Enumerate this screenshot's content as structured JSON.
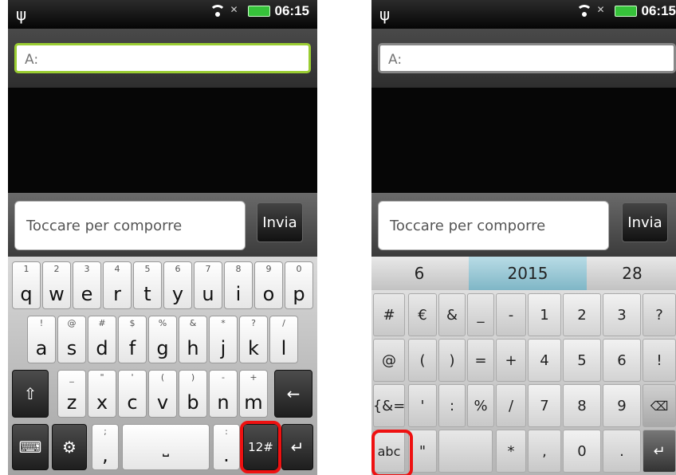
{
  "status": {
    "time": "06:15"
  },
  "compose": {
    "to_label": "A:",
    "placeholder": "Toccare per comporre",
    "send_label": "Invia"
  },
  "keyboard_alpha": {
    "row1": [
      {
        "p": "q",
        "s": "1"
      },
      {
        "p": "w",
        "s": "2"
      },
      {
        "p": "e",
        "s": "3"
      },
      {
        "p": "r",
        "s": "4"
      },
      {
        "p": "t",
        "s": "5"
      },
      {
        "p": "y",
        "s": "6"
      },
      {
        "p": "u",
        "s": "7"
      },
      {
        "p": "i",
        "s": "8"
      },
      {
        "p": "o",
        "s": "9"
      },
      {
        "p": "p",
        "s": "0"
      }
    ],
    "row2": [
      {
        "p": "a",
        "s": "!"
      },
      {
        "p": "s",
        "s": "@"
      },
      {
        "p": "d",
        "s": "#"
      },
      {
        "p": "f",
        "s": "$"
      },
      {
        "p": "g",
        "s": "%"
      },
      {
        "p": "h",
        "s": "&"
      },
      {
        "p": "j",
        "s": "*"
      },
      {
        "p": "k",
        "s": "?"
      },
      {
        "p": "l",
        "s": "/"
      }
    ],
    "row3": [
      {
        "p": "z",
        "s": "_"
      },
      {
        "p": "x",
        "s": "\""
      },
      {
        "p": "c",
        "s": "'"
      },
      {
        "p": "v",
        "s": "("
      },
      {
        "p": "b",
        "s": ")"
      },
      {
        "p": "n",
        "s": "-"
      },
      {
        "p": "m",
        "s": "+"
      }
    ],
    "comma_key": {
      "p": ",",
      "s": ";"
    },
    "period_key": {
      "p": ".",
      "s": ":"
    },
    "mode_key": "12#",
    "space_symbol": "⎵"
  },
  "date_picker": {
    "day": "6",
    "year": "2015",
    "month_day": "28"
  },
  "keyboard_num": {
    "row1": [
      "#",
      "€",
      "&",
      "_",
      "-",
      "1",
      "2",
      "3",
      "?"
    ],
    "row2": [
      "@",
      "(",
      ")",
      "=",
      "+",
      "4",
      "5",
      "6",
      "!"
    ],
    "row3": [
      "{&=",
      "'",
      ":",
      "%",
      "/",
      "7",
      "8",
      "9",
      "⌫"
    ],
    "row4": [
      "abc",
      "\"",
      "",
      "*",
      ",",
      "0",
      "."
    ]
  },
  "colors": {
    "accent_green": "#9acd32",
    "highlight_red": "#e11111"
  }
}
